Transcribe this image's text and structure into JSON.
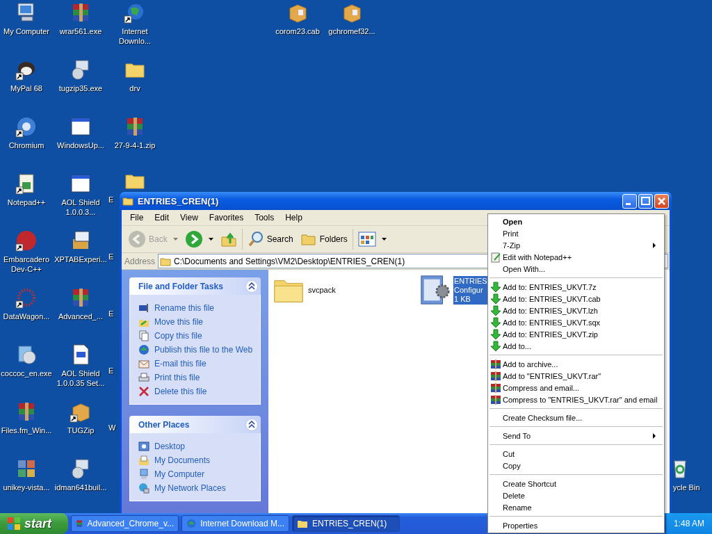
{
  "desktop": {
    "columns": [
      [
        {
          "label": "My Computer",
          "kind": "computer",
          "shortcut": false
        },
        {
          "label": "MyPal 68",
          "kind": "mascot",
          "shortcut": true
        },
        {
          "label": "Chromium",
          "kind": "sphere",
          "shortcut": true
        },
        {
          "label": "Notepad++",
          "kind": "notepad",
          "shortcut": true
        },
        {
          "label": "Embarcadero Dev-C++",
          "kind": "dev",
          "shortcut": true
        },
        {
          "label": "DataWagon...",
          "kind": "dots",
          "shortcut": true
        },
        {
          "label": "coccoc_en.exe",
          "kind": "cd",
          "shortcut": false
        },
        {
          "label": "Files.fm_Win...",
          "kind": "rar",
          "shortcut": false
        },
        {
          "label": "unikey-vista...",
          "kind": "tiles",
          "shortcut": false
        }
      ],
      [
        {
          "label": "wrar561.exe",
          "kind": "rar",
          "shortcut": false
        },
        {
          "label": "tugzip35.exe",
          "kind": "installer",
          "shortcut": false
        },
        {
          "label": "WindowsUp...",
          "kind": "window",
          "shortcut": false
        },
        {
          "label": "AOL Shield 1.0.0.3...",
          "kind": "window",
          "shortcut": false
        },
        {
          "label": "XPTABExperi...",
          "kind": "package",
          "shortcut": false
        },
        {
          "label": "Advanced_...",
          "kind": "rar",
          "shortcut": false
        },
        {
          "label": "AOL Shield 1.0.0.35 Set...",
          "kind": "document",
          "shortcut": false
        },
        {
          "label": "TUGZip",
          "kind": "box",
          "shortcut": true
        },
        {
          "label": "idman641buil...",
          "kind": "installer",
          "shortcut": false
        }
      ],
      [
        {
          "label": "Internet Downlo...",
          "kind": "globe",
          "shortcut": true
        },
        {
          "label": "drv",
          "kind": "folder",
          "shortcut": false
        },
        {
          "label": "27-9-4-1.zip",
          "kind": "rar",
          "shortcut": false
        },
        {
          "label": "E",
          "kind": "clipped-folder"
        },
        {
          "label": "E",
          "kind": "clipped"
        },
        {
          "label": "E",
          "kind": "clipped"
        },
        {
          "label": "E",
          "kind": "clipped"
        },
        {
          "label": "W",
          "kind": "clipped"
        }
      ]
    ],
    "top_icons": [
      {
        "label": "corom23.cab",
        "kind": "box"
      },
      {
        "label": "gchromef32...",
        "kind": "box"
      }
    ],
    "recycle_bin": {
      "label": "ycle Bin"
    }
  },
  "window": {
    "title": "ENTRIES_CREN(1)",
    "menu": [
      "File",
      "Edit",
      "View",
      "Favorites",
      "Tools",
      "Help"
    ],
    "toolbar": [
      {
        "label": "Back",
        "kind": "back",
        "disabled": true
      },
      {
        "kind": "forward",
        "disabled": false
      },
      {
        "kind": "up",
        "disabled": false
      },
      {
        "label": "Search",
        "kind": "search",
        "disabled": false
      },
      {
        "label": "Folders",
        "kind": "folders",
        "disabled": false
      },
      {
        "kind": "views",
        "disabled": false
      }
    ],
    "address": {
      "label": "Address",
      "value": "C:\\Documents and Settings\\VM2\\Desktop\\ENTRIES_CREN(1)"
    },
    "panels": [
      {
        "title": "File and Folder Tasks",
        "expanded": true,
        "items": [
          {
            "label": "Rename this file",
            "kind": "rename"
          },
          {
            "label": "Move this file",
            "kind": "move"
          },
          {
            "label": "Copy this file",
            "kind": "copy"
          },
          {
            "label": "Publish this file to the Web",
            "kind": "globe"
          },
          {
            "label": "E-mail this file",
            "kind": "email"
          },
          {
            "label": "Print this file",
            "kind": "print"
          },
          {
            "label": "Delete this file",
            "kind": "delete"
          }
        ]
      },
      {
        "title": "Other Places",
        "expanded": true,
        "items": [
          {
            "label": "Desktop",
            "kind": "desktop"
          },
          {
            "label": "My Documents",
            "kind": "documents"
          },
          {
            "label": "My Computer",
            "kind": "computer"
          },
          {
            "label": "My Network Places",
            "kind": "network"
          }
        ]
      }
    ],
    "files": [
      {
        "lines": [
          "svcpack"
        ],
        "kind": "folder",
        "selected": false
      },
      {
        "lines": [
          "ENTRIES",
          "Configur",
          "1 KB"
        ],
        "kind": "config",
        "selected": true
      }
    ]
  },
  "context_menu": [
    [
      {
        "label": "Open",
        "kind": "default"
      },
      {
        "label": "Print",
        "kind": "plain"
      },
      {
        "label": "7-Zip",
        "kind": "submenu"
      },
      {
        "label": "Edit with Notepad++",
        "kind": "notepad"
      },
      {
        "label": "Open With...",
        "kind": "plain"
      }
    ],
    [
      {
        "label": "Add to: ENTRIES_UKVT.7z",
        "kind": "arrow"
      },
      {
        "label": "Add to: ENTRIES_UKVT.cab",
        "kind": "arrow"
      },
      {
        "label": "Add to: ENTRIES_UKVT.lzh",
        "kind": "arrow"
      },
      {
        "label": "Add to: ENTRIES_UKVT.sqx",
        "kind": "arrow"
      },
      {
        "label": "Add to: ENTRIES_UKVT.zip",
        "kind": "arrow"
      },
      {
        "label": "Add to...",
        "kind": "arrow"
      }
    ],
    [
      {
        "label": "Add to archive...",
        "kind": "rar"
      },
      {
        "label": "Add to \"ENTRIES_UKVT.rar\"",
        "kind": "rar"
      },
      {
        "label": "Compress and email...",
        "kind": "rar"
      },
      {
        "label": "Compress to \"ENTRIES_UKVT.rar\" and email",
        "kind": "rar"
      }
    ],
    [
      {
        "label": "Create Checksum file...",
        "kind": "plain"
      }
    ],
    [
      {
        "label": "Send To",
        "kind": "submenu"
      }
    ],
    [
      {
        "label": "Cut",
        "kind": "plain"
      },
      {
        "label": "Copy",
        "kind": "plain"
      }
    ],
    [
      {
        "label": "Create Shortcut",
        "kind": "plain"
      },
      {
        "label": "Delete",
        "kind": "plain"
      },
      {
        "label": "Rename",
        "kind": "plain"
      }
    ],
    [
      {
        "label": "Properties",
        "kind": "plain"
      }
    ]
  ],
  "taskbar": {
    "start": "start",
    "tasks": [
      {
        "label": "Advanced_Chrome_v...",
        "kind": "rar",
        "selected": false
      },
      {
        "label": "Internet Download M...",
        "kind": "globe",
        "selected": false
      },
      {
        "label": "ENTRIES_CREN(1)",
        "kind": "folder",
        "selected": true
      }
    ],
    "clock": "1:48 AM"
  }
}
